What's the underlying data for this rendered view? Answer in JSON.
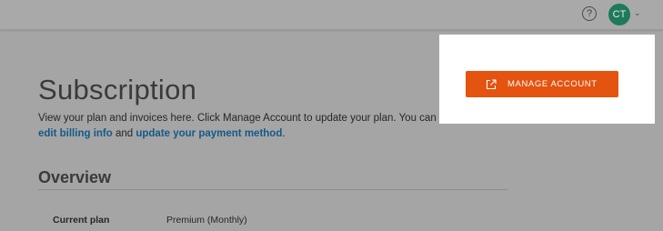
{
  "header": {
    "help_icon": "?",
    "avatar_initials": "CT",
    "menu_chevron": "⌄"
  },
  "page": {
    "title": "Subscription",
    "description_before": "View your plan and invoices here. Click Manage Account to update your plan. You can also ",
    "link_billing": "edit billing info",
    "description_mid": " and ",
    "link_payment": "update your payment method",
    "description_end": "."
  },
  "overview": {
    "title": "Overview",
    "rows": [
      {
        "label": "Current plan",
        "value": "Premium (Monthly)"
      }
    ]
  },
  "manage_account": {
    "label": "MANAGE ACCOUNT",
    "icon": "external-link-icon",
    "color": "#e4530f"
  }
}
